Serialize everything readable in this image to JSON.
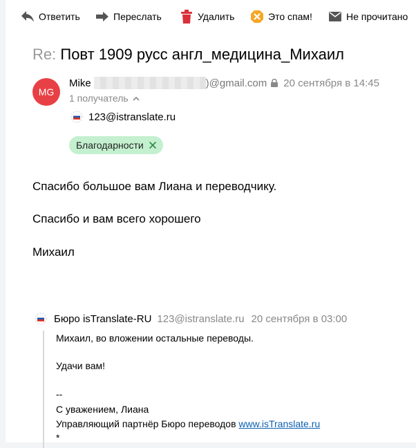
{
  "toolbar": {
    "reply_label": "Ответить",
    "forward_label": "Переслать",
    "delete_label": "Удалить",
    "spam_label": "Это спам!",
    "unread_label": "Не прочитано"
  },
  "message": {
    "subject_prefix": "Re:",
    "subject": "Повт 1909 русс англ_медицина_Михаил",
    "avatar_initials": "MG",
    "sender_name": "Mike",
    "sender_domain": ")@gmail.com",
    "date": "20 сентября в 14:45",
    "recipients_toggle": "1 получатель",
    "recipient_email": "123@istranslate.ru",
    "tag_label": "Благодарности",
    "body": [
      "Спасибо большое вам Лиана и переводчику.",
      "Спасибо и вам всего хорошего",
      "Михаил"
    ]
  },
  "quoted": {
    "sender_name": "Бюро isTranslate-RU",
    "sender_email": "123@istranslate.ru",
    "date": "20 сентября в 03:00",
    "line1": "Михаил, во вложении остальные переводы.",
    "line2": "Удачи вам!",
    "line3": "--",
    "line4": "С уважением, Лиана",
    "line5_prefix": "Управляющий партнёр Бюро переводов",
    "line5_link": "www.isTranslate.ru",
    "line6": "*"
  },
  "colors": {
    "avatar_bg": "#e84145",
    "tag_bg": "#c4f0cf",
    "link": "#0b5fb0",
    "delete_icon": "#d9303a",
    "spam_icon": "#f5a623"
  },
  "icons": {
    "reply": "reply-arrow-icon",
    "forward": "forward-arrow-icon",
    "delete": "trash-icon",
    "spam": "spam-icon",
    "unread": "envelope-icon",
    "lock": "lock-icon",
    "chevron": "chevron-up-icon",
    "flag": "flag-icon",
    "tag_remove": "close-icon"
  }
}
